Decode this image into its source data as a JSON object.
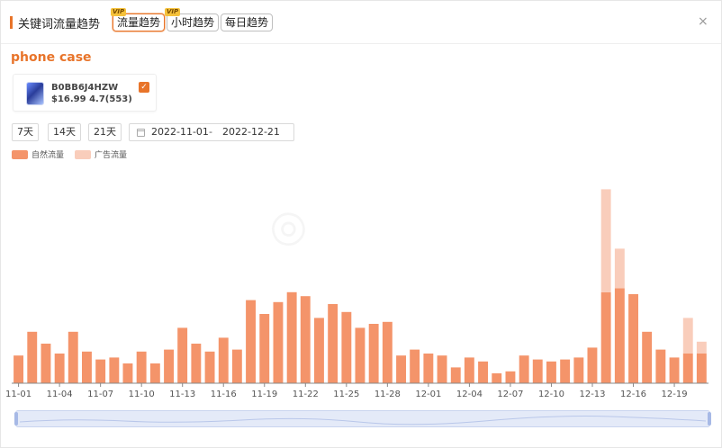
{
  "header": {
    "title": "关键词流量趋势",
    "tabs": [
      {
        "label": "流量趋势",
        "vip": "VIP",
        "active": true
      },
      {
        "label": "小时趋势",
        "vip": "VIP",
        "active": false
      },
      {
        "label": "每日趋势",
        "vip": "",
        "active": false
      }
    ],
    "close_icon": "×"
  },
  "keyword": "phone case",
  "product": {
    "asin": "B0BB6J4HZW",
    "price_rating": "$16.99 4.7(553)",
    "checked": true,
    "check_glyph": "✓"
  },
  "range_buttons": [
    "7天",
    "14天",
    "21天"
  ],
  "date_range": {
    "start": "2022-11-01",
    "separator": "-",
    "end": "2022-12-21"
  },
  "legend": [
    {
      "label": "自然流量",
      "color": "#f4946a"
    },
    {
      "label": "广告流量",
      "color": "#f9cdbb"
    }
  ],
  "colors": {
    "accent": "#e8742a",
    "organic": "#f4946a",
    "ad": "#f9cdbb"
  },
  "chart_data": {
    "type": "bar",
    "stacked": true,
    "x": [
      "11-01",
      "11-02",
      "11-03",
      "11-04",
      "11-05",
      "11-06",
      "11-07",
      "11-08",
      "11-09",
      "11-10",
      "11-11",
      "11-12",
      "11-13",
      "11-14",
      "11-15",
      "11-16",
      "11-17",
      "11-18",
      "11-19",
      "11-20",
      "11-21",
      "11-22",
      "11-23",
      "11-24",
      "11-25",
      "11-26",
      "11-27",
      "11-28",
      "11-29",
      "11-30",
      "12-01",
      "12-02",
      "12-03",
      "12-04",
      "12-05",
      "12-06",
      "12-07",
      "12-08",
      "12-09",
      "12-10",
      "12-11",
      "12-12",
      "12-13",
      "12-14",
      "12-15",
      "12-16",
      "12-17",
      "12-18",
      "12-19",
      "12-20",
      "12-21"
    ],
    "x_tick_labels": [
      "11-01",
      "11-04",
      "11-07",
      "11-10",
      "11-13",
      "11-16",
      "11-19",
      "11-22",
      "11-25",
      "11-28",
      "12-01",
      "12-04",
      "12-07",
      "12-10",
      "12-13",
      "12-16",
      "12-19"
    ],
    "series": [
      {
        "name": "自然流量",
        "values": [
          14,
          26,
          20,
          15,
          26,
          16,
          12,
          13,
          10,
          16,
          10,
          17,
          28,
          20,
          16,
          23,
          17,
          42,
          35,
          41,
          46,
          44,
          33,
          40,
          36,
          28,
          30,
          31,
          14,
          17,
          15,
          14,
          8,
          13,
          11,
          5,
          6,
          14,
          12,
          11,
          12,
          13,
          18,
          46,
          48,
          45,
          26,
          17,
          13,
          15,
          15
        ]
      },
      {
        "name": "广告流量",
        "values": [
          0,
          0,
          0,
          0,
          0,
          0,
          0,
          0,
          0,
          0,
          0,
          0,
          0,
          0,
          0,
          0,
          0,
          0,
          0,
          0,
          0,
          0,
          0,
          0,
          0,
          0,
          0,
          0,
          0,
          0,
          0,
          0,
          0,
          0,
          0,
          0,
          0,
          0,
          0,
          0,
          0,
          0,
          0,
          52,
          20,
          0,
          0,
          0,
          0,
          18,
          6
        ]
      }
    ],
    "ylim": [
      0,
      100
    ],
    "grid": false,
    "legend_position": "top-left"
  }
}
